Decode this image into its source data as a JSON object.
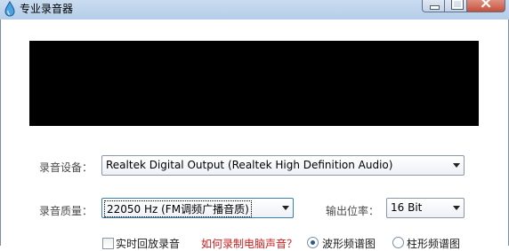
{
  "window": {
    "title": "专业录音器",
    "controls": [
      "minimize",
      "maximize",
      "close"
    ]
  },
  "form": {
    "device_label": "录音设备：",
    "device_value": "Realtek Digital Output (Realtek High Definition Audio)",
    "quality_label": "录音质量：",
    "quality_value": "22050 Hz (FM调频广播音质)",
    "bitrate_label": "输出位率：",
    "bitrate_value": "16 Bit"
  },
  "options": {
    "monitor_label": "实时回放录音",
    "monitor_checked": false,
    "help_link": "如何录制电脑声音？",
    "wave_label": "波形频谱图",
    "bar_label": "柱形频谱图",
    "selected_view": "wave"
  },
  "colors": {
    "link": "#c81e1e",
    "display_bg": "#000000"
  }
}
